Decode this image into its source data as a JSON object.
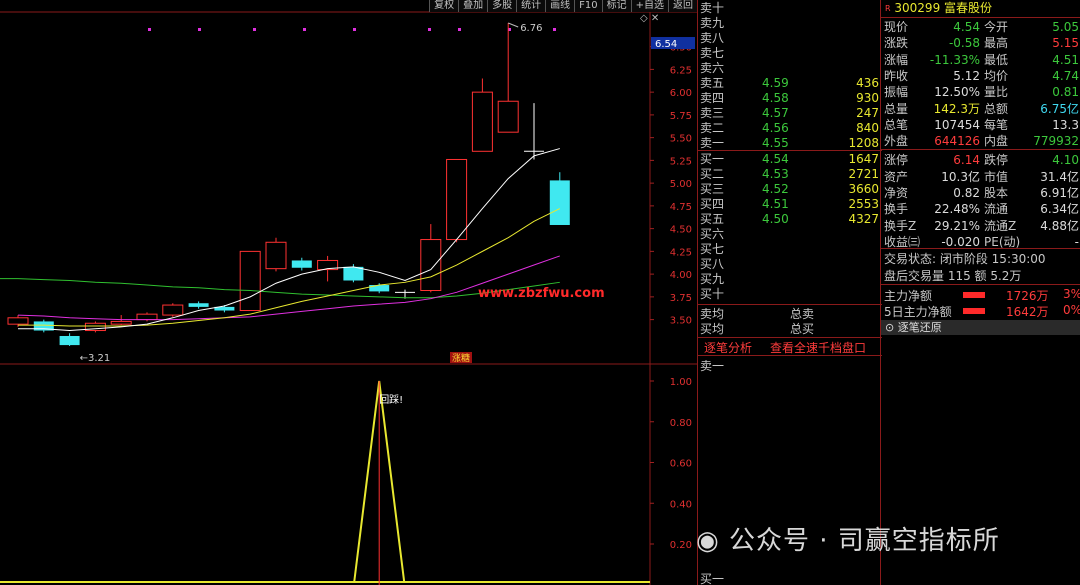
{
  "toolbar": [
    "复权",
    "叠加",
    "多股",
    "统计",
    "画线",
    "F10",
    "标记",
    "+自选",
    "返回"
  ],
  "chart": {
    "price_axis": [
      "6.50",
      "6.25",
      "6.00",
      "5.75",
      "5.50",
      "5.25",
      "5.00",
      "4.75",
      "4.50",
      "4.25",
      "4.00",
      "3.75",
      "3.50"
    ],
    "current_price_tag": "6.54",
    "high_label": "6.76",
    "low_label": "3.21",
    "watermark_url": "www.zbzfwu.com",
    "zhangting_tag": "涨糖",
    "indicator_axis": [
      "1.00",
      "0.80",
      "0.60",
      "0.40",
      "0.20"
    ],
    "indicator_label": "回踩!",
    "colors": {
      "up": "#ff3232",
      "down": "#40e8f0",
      "ma5": "#ffffff",
      "ma10": "#e8e830",
      "ma20": "#e030e0",
      "ma60": "#30c030"
    }
  },
  "chart_data": {
    "type": "candlestick",
    "candles": [
      {
        "o": 3.45,
        "c": 3.52,
        "h": 3.55,
        "l": 3.42
      },
      {
        "o": 3.48,
        "c": 3.38,
        "h": 3.5,
        "l": 3.36
      },
      {
        "o": 3.32,
        "c": 3.22,
        "h": 3.35,
        "l": 3.21
      },
      {
        "o": 3.38,
        "c": 3.46,
        "h": 3.48,
        "l": 3.36
      },
      {
        "o": 3.45,
        "c": 3.48,
        "h": 3.55,
        "l": 3.44
      },
      {
        "o": 3.5,
        "c": 3.56,
        "h": 3.58,
        "l": 3.48
      },
      {
        "o": 3.55,
        "c": 3.66,
        "h": 3.68,
        "l": 3.53
      },
      {
        "o": 3.68,
        "c": 3.64,
        "h": 3.7,
        "l": 3.62
      },
      {
        "o": 3.64,
        "c": 3.6,
        "h": 3.66,
        "l": 3.58
      },
      {
        "o": 3.6,
        "c": 4.25,
        "h": 4.25,
        "l": 3.6
      },
      {
        "o": 4.06,
        "c": 4.35,
        "h": 4.4,
        "l": 4.03
      },
      {
        "o": 4.15,
        "c": 4.07,
        "h": 4.18,
        "l": 4.04
      },
      {
        "o": 4.05,
        "c": 4.15,
        "h": 4.2,
        "l": 3.92
      },
      {
        "o": 4.08,
        "c": 3.93,
        "h": 4.11,
        "l": 3.91
      },
      {
        "o": 3.88,
        "c": 3.81,
        "h": 3.9,
        "l": 3.79
      },
      {
        "o": 3.8,
        "c": 3.8,
        "h": 3.83,
        "l": 3.73
      },
      {
        "o": 3.82,
        "c": 4.38,
        "h": 4.55,
        "l": 3.8
      },
      {
        "o": 4.38,
        "c": 5.26,
        "h": 5.26,
        "l": 4.35
      },
      {
        "o": 5.35,
        "c": 6.0,
        "h": 6.15,
        "l": 5.35
      },
      {
        "o": 5.56,
        "c": 5.9,
        "h": 6.76,
        "l": 5.56
      },
      {
        "o": 5.35,
        "c": 5.35,
        "h": 5.88,
        "l": 5.26
      },
      {
        "o": 5.03,
        "c": 4.54,
        "h": 5.12,
        "l": 4.54
      }
    ],
    "ma5": [
      3.4,
      3.4,
      3.38,
      3.4,
      3.42,
      3.45,
      3.52,
      3.6,
      3.65,
      3.75,
      3.9,
      4.0,
      4.06,
      4.08,
      4.02,
      3.93,
      4.05,
      4.38,
      4.72,
      5.05,
      5.3,
      5.38
    ],
    "ma10": [
      3.44,
      3.44,
      3.43,
      3.43,
      3.43,
      3.44,
      3.46,
      3.49,
      3.52,
      3.56,
      3.63,
      3.7,
      3.76,
      3.82,
      3.88,
      3.91,
      3.97,
      4.1,
      4.25,
      4.4,
      4.58,
      4.72
    ],
    "ma20": [
      3.55,
      3.54,
      3.52,
      3.51,
      3.5,
      3.5,
      3.5,
      3.51,
      3.52,
      3.53,
      3.56,
      3.59,
      3.62,
      3.65,
      3.67,
      3.69,
      3.73,
      3.8,
      3.9,
      4.0,
      4.1,
      4.2
    ],
    "ma60": [
      3.95,
      3.94,
      3.93,
      3.91,
      3.9,
      3.88,
      3.86,
      3.85,
      3.83,
      3.82,
      3.8,
      3.78,
      3.77,
      3.76,
      3.75,
      3.74,
      3.74,
      3.76,
      3.79,
      3.83,
      3.87,
      3.91
    ],
    "indicator": {
      "signal_value": 1.0,
      "signal_index": 14
    },
    "ylim": [
      3.21,
      6.76
    ]
  },
  "orderbook": {
    "sells_upper": [
      "卖十",
      "卖九",
      "卖八",
      "卖七",
      "卖六"
    ],
    "sells": [
      {
        "label": "卖五",
        "price": "4.59",
        "vol": "436"
      },
      {
        "label": "卖四",
        "price": "4.58",
        "vol": "930"
      },
      {
        "label": "卖三",
        "price": "4.57",
        "vol": "247"
      },
      {
        "label": "卖二",
        "price": "4.56",
        "vol": "840"
      },
      {
        "label": "卖一",
        "price": "4.55",
        "vol": "1208"
      }
    ],
    "buys": [
      {
        "label": "买一",
        "price": "4.54",
        "vol": "1647"
      },
      {
        "label": "买二",
        "price": "4.53",
        "vol": "2721"
      },
      {
        "label": "买三",
        "price": "4.52",
        "vol": "3660"
      },
      {
        "label": "买四",
        "price": "4.51",
        "vol": "2553"
      },
      {
        "label": "买五",
        "price": "4.50",
        "vol": "4327"
      }
    ],
    "buys_lower": [
      "买六",
      "买七",
      "买八",
      "买九",
      "买十"
    ],
    "avg_sell": "卖均",
    "total_sell": "总卖",
    "avg_buy": "买均",
    "total_buy": "总买",
    "tab1": "逐笔分析",
    "tab2": "查看全速千档盘口",
    "trade_sell1": "卖一",
    "trade_buy1": "买一"
  },
  "quote": {
    "flag": "R",
    "code": "300299",
    "name": "富春股份",
    "rows": [
      {
        "l1": "现价",
        "v1": "4.54",
        "c1": "green",
        "l2": "今开",
        "v2": "5.05",
        "c2": "green"
      },
      {
        "l1": "涨跌",
        "v1": "-0.58",
        "c1": "green",
        "l2": "最高",
        "v2": "5.15",
        "c2": "red"
      },
      {
        "l1": "涨幅",
        "v1": "-11.33%",
        "c1": "green",
        "l2": "最低",
        "v2": "4.51",
        "c2": "green"
      },
      {
        "l1": "昨收",
        "v1": "5.12",
        "c1": "white",
        "l2": "均价",
        "v2": "4.74",
        "c2": "green"
      },
      {
        "l1": "振幅",
        "v1": "12.50%",
        "c1": "white",
        "l2": "量比",
        "v2": "0.81",
        "c2": "green"
      },
      {
        "l1": "总量",
        "v1": "142.3万",
        "c1": "yellow",
        "l2": "总额",
        "v2": "6.75亿",
        "c2": "cyan"
      },
      {
        "l1": "总笔",
        "v1": "107454",
        "c1": "white",
        "l2": "每笔",
        "v2": "13.3",
        "c2": "white"
      },
      {
        "l1": "外盘",
        "v1": "644126",
        "c1": "red",
        "l2": "内盘",
        "v2": "779932",
        "c2": "green"
      },
      {
        "l1": "涨停",
        "v1": "6.14",
        "c1": "red",
        "l2": "跌停",
        "v2": "4.10",
        "c2": "green"
      },
      {
        "l1": "资产",
        "v1": "10.3亿",
        "c1": "white",
        "l2": "市值",
        "v2": "31.4亿",
        "c2": "white"
      },
      {
        "l1": "净资",
        "v1": "0.82",
        "c1": "white",
        "l2": "股本",
        "v2": "6.91亿",
        "c2": "white"
      },
      {
        "l1": "换手",
        "v1": "22.48%",
        "c1": "white",
        "l2": "流通",
        "v2": "6.34亿",
        "c2": "white"
      },
      {
        "l1": "换手Z",
        "v1": "29.21%",
        "c1": "white",
        "l2": "流通Z",
        "v2": "4.88亿",
        "c2": "white"
      },
      {
        "l1": "收益㈢",
        "v1": "-0.020",
        "c1": "white",
        "l2": "PE(动)",
        "v2": "-",
        "c2": "white"
      }
    ],
    "status_label": "交易状态: 闭市阶段 15:30:00",
    "after_hours": "盘后交易量 115 额 5.2万",
    "main_net_label": "主力净额",
    "main_net_value": "1726万",
    "main_net_pct": "3%",
    "main5_net_label": "5日主力净额",
    "main5_net_value": "1642万",
    "main5_net_pct": "0%",
    "tick_restore": "逐笔还原"
  },
  "watermark": "公众号 · 司赢空指标所"
}
